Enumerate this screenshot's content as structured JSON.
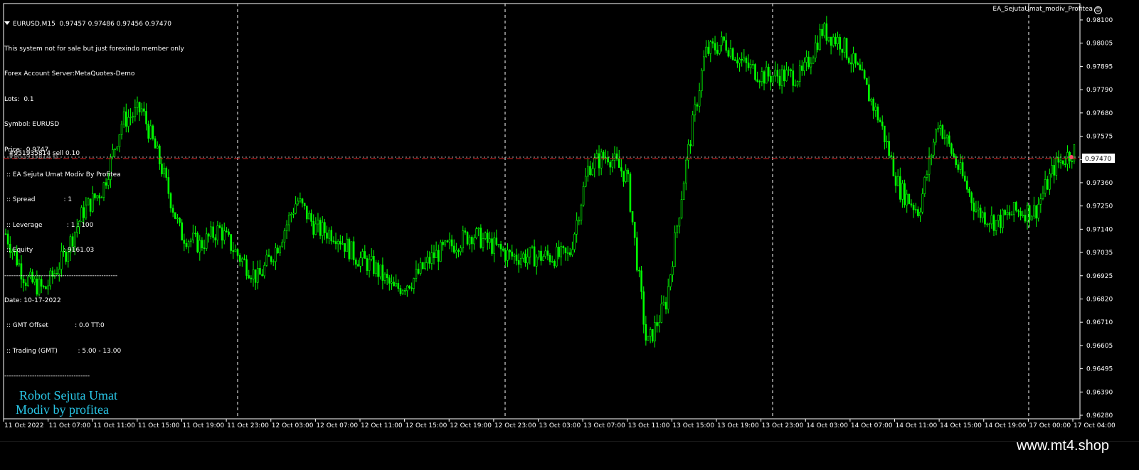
{
  "window": {
    "symbol_line": "EURUSD,M15  0.97457 0.97486 0.97456 0.97470",
    "ea_name": "EA_SejutaUmat_modiv_Profitea"
  },
  "info_lines": [
    "This system not for sale but just forexindo member only",
    "Forex Account Server:MetaQuotes-Demo",
    "Lots:  0.1",
    "Symbol: EURUSD",
    "Price:  0.9747",
    " :: EA Sejuta Umat Modiv By Profitea",
    " :: Spread              : 1",
    " :: Leverage            : 1 : 100",
    " :: Equity               : 9161.03",
    "-------------------------------------------------",
    "Date: 10-17-2022",
    " :: GMT Offset             : 0.0 TT:0",
    " :: Trading (GMT)          : 5.00 - 13.00",
    "-------------------------------------"
  ],
  "order": {
    "label": "#951935814 sell 0.10",
    "label_ghost": "#951935814 sl"
  },
  "branding": {
    "title": "Robot Sejuta Umat",
    "subtitle": "Modiv by profitea",
    "site": "www.mt4.shop"
  },
  "colors": {
    "background": "#000000",
    "candles": "#00ff00",
    "price_line": "#e02020",
    "branding": "#29c6e6",
    "grid": "#ffffff"
  },
  "price_axis": {
    "labels": [
      "0.98100",
      "0.98005",
      "0.97895",
      "0.97790",
      "0.97680",
      "0.97575",
      "0.97470",
      "0.97360",
      "0.97250",
      "0.97140",
      "0.97035",
      "0.96925",
      "0.96820",
      "0.96710",
      "0.96605",
      "0.96495",
      "0.96390",
      "0.96280"
    ],
    "current_price": "0.97470"
  },
  "time_axis": {
    "labels": [
      "11 Oct 2022",
      "11 Oct 07:00",
      "11 Oct 11:00",
      "11 Oct 15:00",
      "11 Oct 19:00",
      "11 Oct 23:00",
      "12 Oct 03:00",
      "12 Oct 07:00",
      "12 Oct 11:00",
      "12 Oct 15:00",
      "12 Oct 19:00",
      "12 Oct 23:00",
      "13 Oct 03:00",
      "13 Oct 07:00",
      "13 Oct 11:00",
      "13 Oct 15:00",
      "13 Oct 19:00",
      "13 Oct 23:00",
      "14 Oct 03:00",
      "14 Oct 07:00",
      "14 Oct 11:00",
      "14 Oct 15:00",
      "14 Oct 19:00",
      "17 Oct 00:00",
      "17 Oct 04:00"
    ]
  },
  "chart_data": {
    "type": "line",
    "title": "EURUSD,M15",
    "ylim": [
      0.9628,
      0.9812
    ],
    "grid": "vertical dashed at day separators",
    "x": [
      "11 Oct 03:00",
      "11 Oct 05:00",
      "11 Oct 07:00",
      "11 Oct 09:00",
      "11 Oct 11:00",
      "11 Oct 13:00",
      "11 Oct 15:00",
      "11 Oct 16:00",
      "11 Oct 17:00",
      "11 Oct 19:00",
      "11 Oct 21:00",
      "11 Oct 23:00",
      "12 Oct 01:00",
      "12 Oct 03:00",
      "12 Oct 05:00",
      "12 Oct 07:00",
      "12 Oct 09:00",
      "12 Oct 11:00",
      "12 Oct 13:00",
      "12 Oct 15:00",
      "12 Oct 16:00",
      "12 Oct 17:00",
      "12 Oct 19:00",
      "12 Oct 21:00",
      "12 Oct 23:00",
      "13 Oct 01:00",
      "13 Oct 03:00",
      "13 Oct 05:00",
      "13 Oct 07:00",
      "13 Oct 09:00",
      "13 Oct 11:00",
      "13 Oct 12:00",
      "13 Oct 12:30",
      "13 Oct 13:30",
      "13 Oct 14:30",
      "13 Oct 15:00",
      "13 Oct 16:00",
      "13 Oct 17:00",
      "13 Oct 19:00",
      "13 Oct 21:00",
      "13 Oct 23:00",
      "14 Oct 01:00",
      "14 Oct 03:00",
      "14 Oct 05:00",
      "14 Oct 07:00",
      "14 Oct 09:00",
      "14 Oct 11:00",
      "14 Oct 13:00",
      "14 Oct 14:00",
      "14 Oct 15:00",
      "14 Oct 17:00",
      "14 Oct 19:00",
      "14 Oct 21:00",
      "17 Oct 00:00",
      "17 Oct 02:00",
      "17 Oct 04:00"
    ],
    "series": [
      {
        "values": [
          0.971,
          0.969,
          0.9685,
          0.97,
          0.972,
          0.973,
          0.976,
          0.9765,
          0.974,
          0.971,
          0.9705,
          0.9712,
          0.97,
          0.969,
          0.9705,
          0.9725,
          0.9712,
          0.971,
          0.97,
          0.9695,
          0.9685,
          0.969,
          0.97,
          0.9705,
          0.971,
          0.9705,
          0.97,
          0.97,
          0.97,
          0.97,
          0.974,
          0.9745,
          0.9735,
          0.966,
          0.968,
          0.974,
          0.979,
          0.9795,
          0.9785,
          0.978,
          0.978,
          0.978,
          0.98,
          0.9795,
          0.978,
          0.976,
          0.973,
          0.972,
          0.976,
          0.974,
          0.972,
          0.9715,
          0.972,
          0.972,
          0.974,
          0.9747
        ]
      }
    ]
  }
}
